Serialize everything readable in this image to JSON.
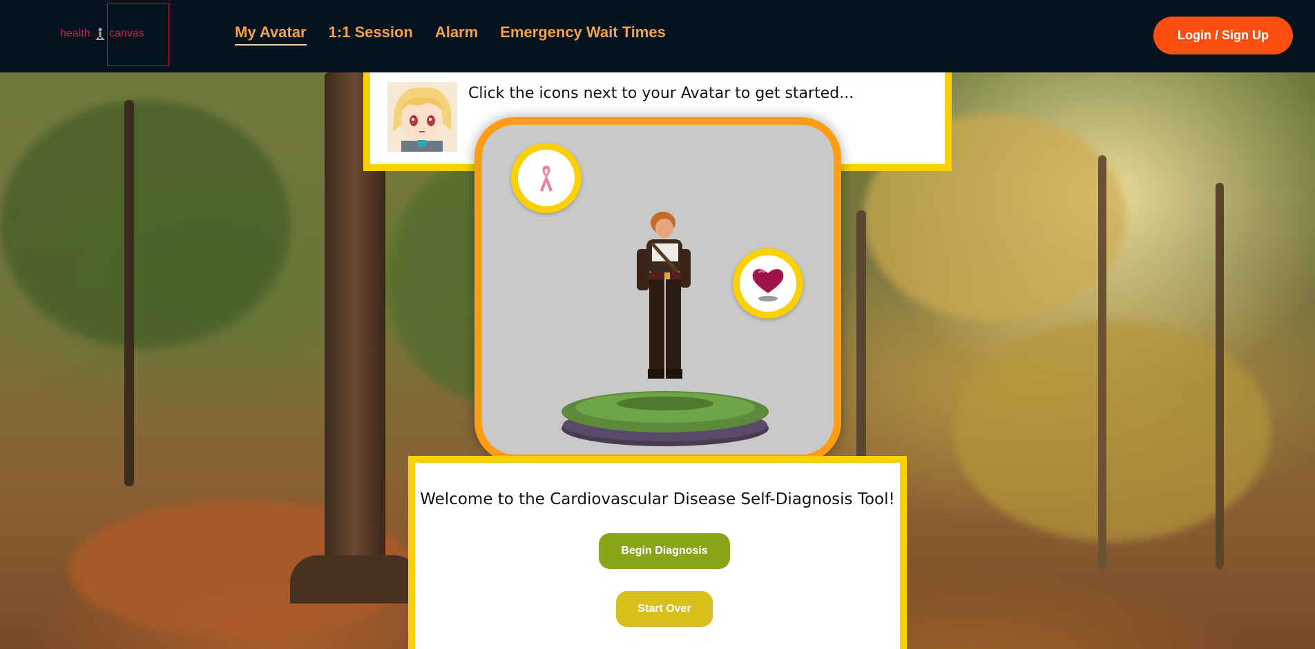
{
  "nav": {
    "logo_left": "health",
    "logo_right": "canvas",
    "items": [
      {
        "label": "My Avatar",
        "active": true
      },
      {
        "label": "1:1 Session"
      },
      {
        "label": "Alarm"
      },
      {
        "label": "Emergency Wait Times"
      }
    ],
    "login_label": "Login / Sign Up"
  },
  "speech": {
    "text": "Click the icons next to your Avatar to get started..."
  },
  "avatar": {
    "icons": [
      "awareness-ribbon-icon",
      "heart-icon"
    ]
  },
  "welcome": {
    "title": "Welcome to the Cardiovascular Disease Self-Diagnosis Tool!",
    "begin_label": "Begin Diagnosis",
    "start_over_label": "Start Over"
  },
  "colors": {
    "nav_bg": "#07131f",
    "nav_link": "#f2a24a",
    "login_bg": "#ff4e11",
    "frame_yellow": "#fbd000",
    "frame_orange": "#ff9d12",
    "begin_bg": "#8aa51a",
    "start_bg": "#d7c01c",
    "logo_red": "#d21c44"
  }
}
